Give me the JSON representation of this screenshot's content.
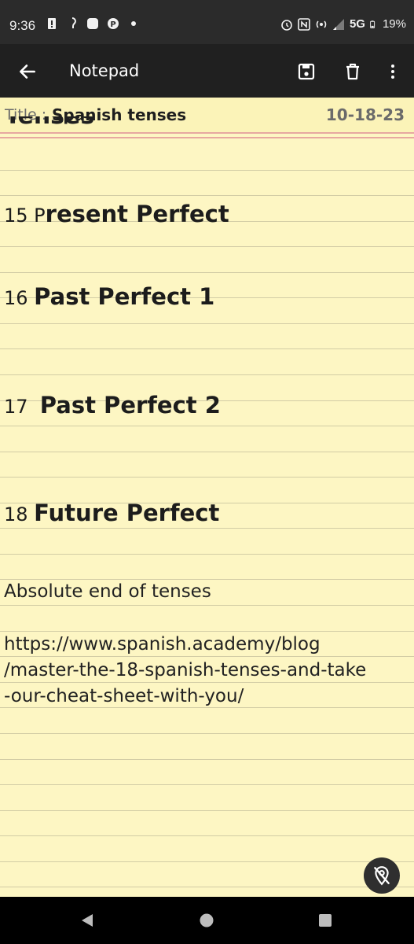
{
  "status_bar": {
    "time": "9:36",
    "network": "5G",
    "battery": "19%",
    "left_icons": [
      "alert-icon",
      "hearing-aid-icon",
      "square-app-icon",
      "parking-app-icon",
      "dot-icon"
    ],
    "right_icons": [
      "alarm-icon",
      "nfc-icon",
      "hotspot-icon",
      "signal-icon",
      "battery-icon"
    ]
  },
  "app_bar": {
    "title": "Notepad",
    "back_icon": "arrow-left-icon",
    "actions": [
      "save-icon",
      "delete-icon",
      "more-vert-icon"
    ]
  },
  "note": {
    "title_label": "Title : ",
    "title": "Spanish tenses",
    "date": "10-18-23",
    "partial_line": "Tenses",
    "items": [
      {
        "number": "15 P",
        "text": "resent Perfect"
      },
      {
        "number": "16 ",
        "text": "Past Perfect 1"
      },
      {
        "number": "17  ",
        "text": "Past Perfect 2"
      },
      {
        "number": "18 ",
        "text": "Future Perfect"
      }
    ],
    "end_text": "Absolute end of tenses",
    "url_lines": [
      "https://www.spanish.academy/blog",
      "/master-the-18-spanish-tenses-and-take",
      "-our-cheat-sheet-with-you/"
    ]
  },
  "fab": {
    "icon": "location-off-icon"
  },
  "nav_bar": {
    "icons": [
      "back-triangle-icon",
      "home-circle-icon",
      "recents-square-icon"
    ]
  },
  "colors": {
    "paper": "#fdf6c3",
    "rule": "#d2cca5",
    "margin_line": "#e7a8a0",
    "app_bar": "#202020",
    "status_bar": "#2b2b2b"
  }
}
